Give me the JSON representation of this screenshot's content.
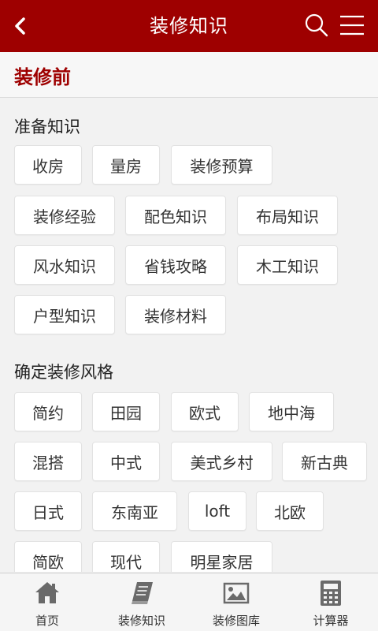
{
  "header": {
    "title": "装修知识",
    "back_icon": "chevron-left-icon",
    "search_icon": "search-icon",
    "menu_icon": "menu-icon"
  },
  "section": {
    "title": "装修前"
  },
  "groups": [
    {
      "title": "准备知识",
      "tags": [
        "收房",
        "量房",
        "装修预算",
        "装修经验",
        "配色知识",
        "布局知识",
        "风水知识",
        "省钱攻略",
        "木工知识",
        "户型知识",
        "装修材料"
      ]
    },
    {
      "title": "确定装修风格",
      "tags": [
        "简约",
        "田园",
        "欧式",
        "地中海",
        "混搭",
        "中式",
        "美式乡村",
        "新古典",
        "日式",
        "东南亚",
        "loft",
        "北欧",
        "简欧",
        "现代",
        "明星家居"
      ]
    }
  ],
  "tabbar": {
    "items": [
      {
        "label": "首页",
        "icon": "home-icon"
      },
      {
        "label": "装修知识",
        "icon": "book-icon"
      },
      {
        "label": "装修图库",
        "icon": "image-icon"
      },
      {
        "label": "计算器",
        "icon": "calculator-icon"
      }
    ]
  },
  "colors": {
    "brand": "#9e0000",
    "background": "#f2f2f2"
  }
}
